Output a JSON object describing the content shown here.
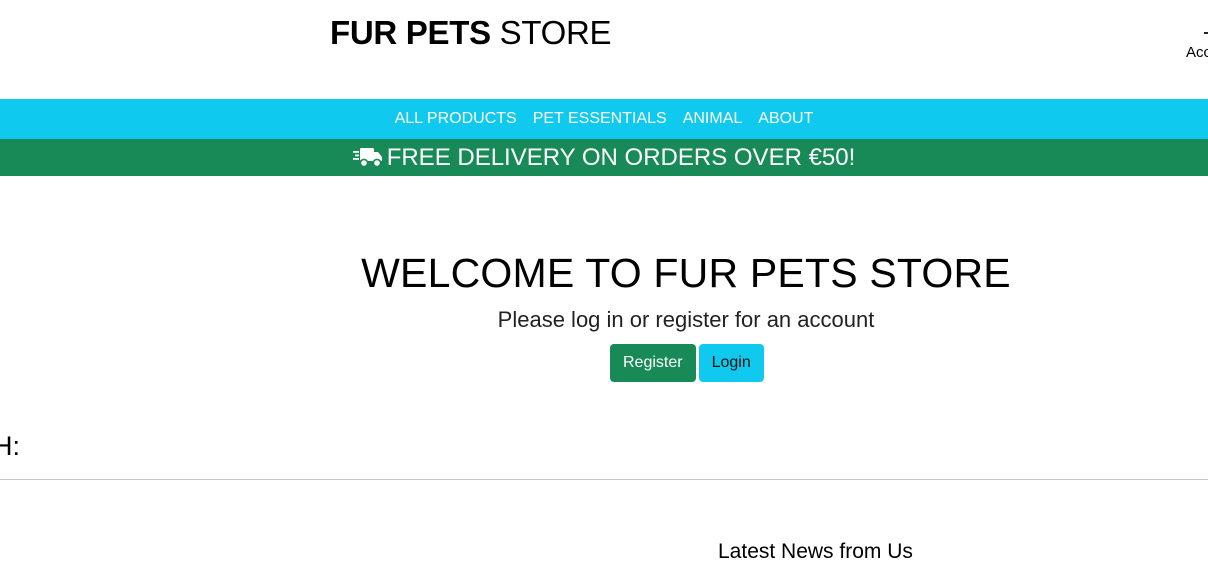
{
  "header": {
    "brand_bold": "FUR PETS",
    "brand_regular": "STORE",
    "account_label": "Account"
  },
  "nav": {
    "items": [
      {
        "label": "ALL PRODUCTS"
      },
      {
        "label": "PET ESSENTIALS"
      },
      {
        "label": "ANIMAL"
      },
      {
        "label": "ABOUT"
      }
    ]
  },
  "banner": {
    "icon": "truck-icon",
    "text": "FREE DELIVERY ON ORDERS OVER €50!"
  },
  "main": {
    "title": "WELCOME TO FUR PETS STORE",
    "subtitle": "Please log in or register for an account",
    "register_label": "Register",
    "login_label": "Login"
  },
  "section": {
    "search_label": "H:",
    "news_heading": "Latest News from Us"
  },
  "colors": {
    "nav_bg": "#10c9ef",
    "banner_bg": "#178a57",
    "register_bg": "#178a57",
    "login_bg": "#10c9ef"
  }
}
